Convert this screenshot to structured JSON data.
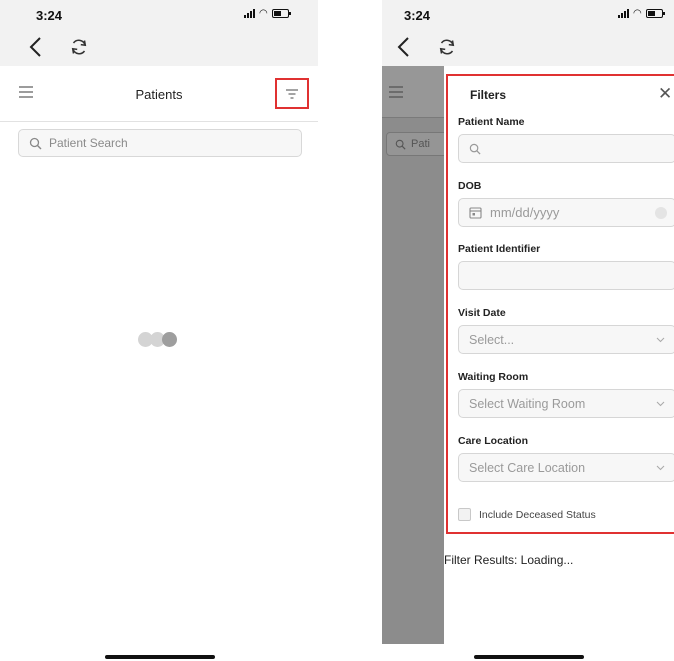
{
  "left_screen": {
    "status_time": "3:24",
    "header_title": "Patients",
    "search_placeholder": "Patient Search",
    "loader_colors": [
      "#d4d4d4",
      "#d4d4d4",
      "#9e9e9e"
    ]
  },
  "right_screen": {
    "status_time": "3:24",
    "overlay_search_text": "Pati",
    "filters": {
      "title": "Filters",
      "patient_name_label": "Patient Name",
      "patient_name_value": "",
      "dob_label": "DOB",
      "dob_placeholder": "mm/dd/yyyy",
      "patient_identifier_label": "Patient Identifier",
      "patient_identifier_value": "",
      "visit_date_label": "Visit Date",
      "visit_date_selected": "Select...",
      "waiting_room_label": "Waiting Room",
      "waiting_room_selected": "Select Waiting Room",
      "care_location_label": "Care Location",
      "care_location_selected": "Select Care Location",
      "include_deceased_label": "Include Deceased Status",
      "include_deceased_checked": false
    },
    "filter_results_text": "Filter Results: Loading..."
  },
  "colors": {
    "highlight": "#e03131",
    "overlay": "#8c8c8c",
    "status_bar_bg": "#f2f2f2"
  },
  "icons": [
    "back-chevron-icon",
    "refresh-icon",
    "hamburger-menu-icon",
    "filter-icon",
    "search-icon",
    "calendar-icon",
    "chevron-down-icon",
    "close-icon"
  ]
}
